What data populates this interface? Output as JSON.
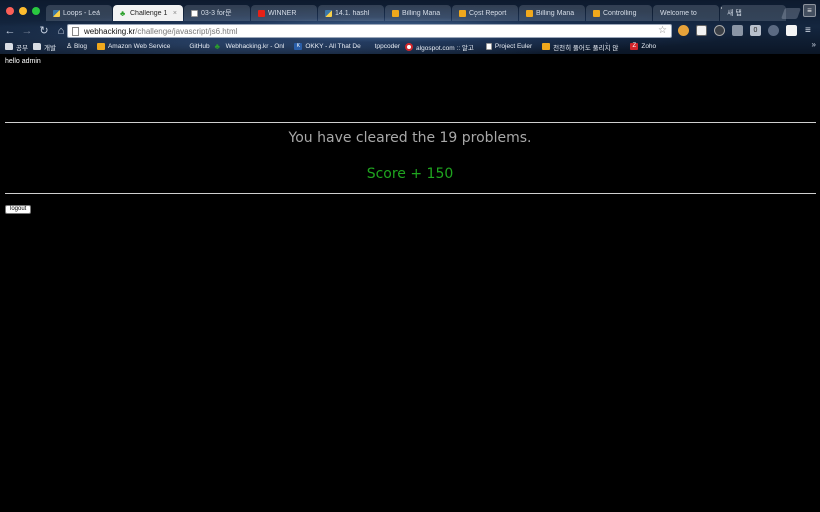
{
  "browser": {
    "tabs": [
      {
        "label": "Loops - Lea",
        "favicon": "python-icon",
        "active": false
      },
      {
        "label": "Challenge 1",
        "favicon": "clover-icon",
        "active": true
      },
      {
        "label": "03-3 for문",
        "favicon": "document-icon",
        "active": false
      },
      {
        "label": "WINNER",
        "favicon": "youtube-icon",
        "active": false
      },
      {
        "label": "14.1. hashl",
        "favicon": "python-icon",
        "active": false
      },
      {
        "label": "Billing Mana",
        "favicon": "box-icon",
        "active": false
      },
      {
        "label": "Cost Report",
        "favicon": "box-icon",
        "active": false
      },
      {
        "label": "Billing Mana",
        "favicon": "box-icon",
        "active": false
      },
      {
        "label": "Controlling",
        "favicon": "box-icon",
        "active": false
      },
      {
        "label": "Welcome to",
        "favicon": "",
        "active": false
      },
      {
        "label": "새 탭",
        "favicon": "",
        "active": false
      }
    ],
    "tab_close_glyph": "×",
    "address": {
      "host": "webhacking.kr",
      "path": "/challenge/javascript/js6.html"
    },
    "bookmarks": [
      {
        "label": "공부",
        "icon": "folder-icon"
      },
      {
        "label": "개발",
        "icon": "folder-icon"
      },
      {
        "label": "Blog",
        "icon": "person-icon"
      },
      {
        "label": "Amazon Web Service",
        "icon": "box-icon"
      },
      {
        "label": "GitHub",
        "icon": "github-icon"
      },
      {
        "label": "Webhacking.kr - Onl",
        "icon": "clover-icon"
      },
      {
        "label": "OKKY - All That De",
        "icon": "okky-icon"
      },
      {
        "label": "topcoder",
        "icon": "topcoder-icon"
      },
      {
        "label": "algospot.com :: 알고",
        "icon": "target-icon"
      },
      {
        "label": "Project Euler",
        "icon": "document-icon"
      },
      {
        "label": "천천히 풀어도 풀리지 않",
        "icon": "box-icon"
      },
      {
        "label": "Zoho",
        "icon": "zoho-icon"
      }
    ],
    "bookmarks_overflow": "»",
    "extensions": [
      "cookie-icon",
      "pocket-icon",
      "refresh-ext-icon",
      "screen-ext-icon",
      "badge-ext-icon",
      "globe-ext-icon",
      "blank-ext-icon"
    ],
    "extension_badge": "0",
    "profile_glyph": "≡"
  },
  "page": {
    "greeting": "hello admin",
    "cleared_message": "You have cleared the 19 problems.",
    "score_message": "Score + 150",
    "logout_label": "logout"
  },
  "colors": {
    "background": "#000000",
    "cleared_text": "#a8a8a8",
    "score_text": "#1fa51f",
    "rule": "#cfcfcf"
  }
}
